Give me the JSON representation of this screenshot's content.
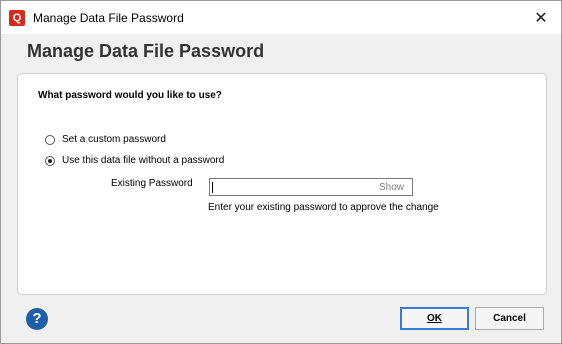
{
  "window": {
    "title": "Manage Data File Password",
    "app_icon_letter": "Q",
    "close_glyph": "✕"
  },
  "heading": "Manage Data File Password",
  "question": "What password would you like to use?",
  "options": [
    {
      "label": "Set a custom password",
      "checked": false
    },
    {
      "label": "Use this data file without a password",
      "checked": true
    }
  ],
  "existing_password": {
    "label": "Existing Password",
    "value": "",
    "show_label": "Show",
    "hint": "Enter your existing password to approve the change"
  },
  "help_glyph": "?",
  "buttons": {
    "ok": "OK",
    "cancel": "Cancel"
  },
  "colors": {
    "accent": "#3a7bd5",
    "help": "#1f5fa8",
    "app_icon": "#d52b1e"
  }
}
